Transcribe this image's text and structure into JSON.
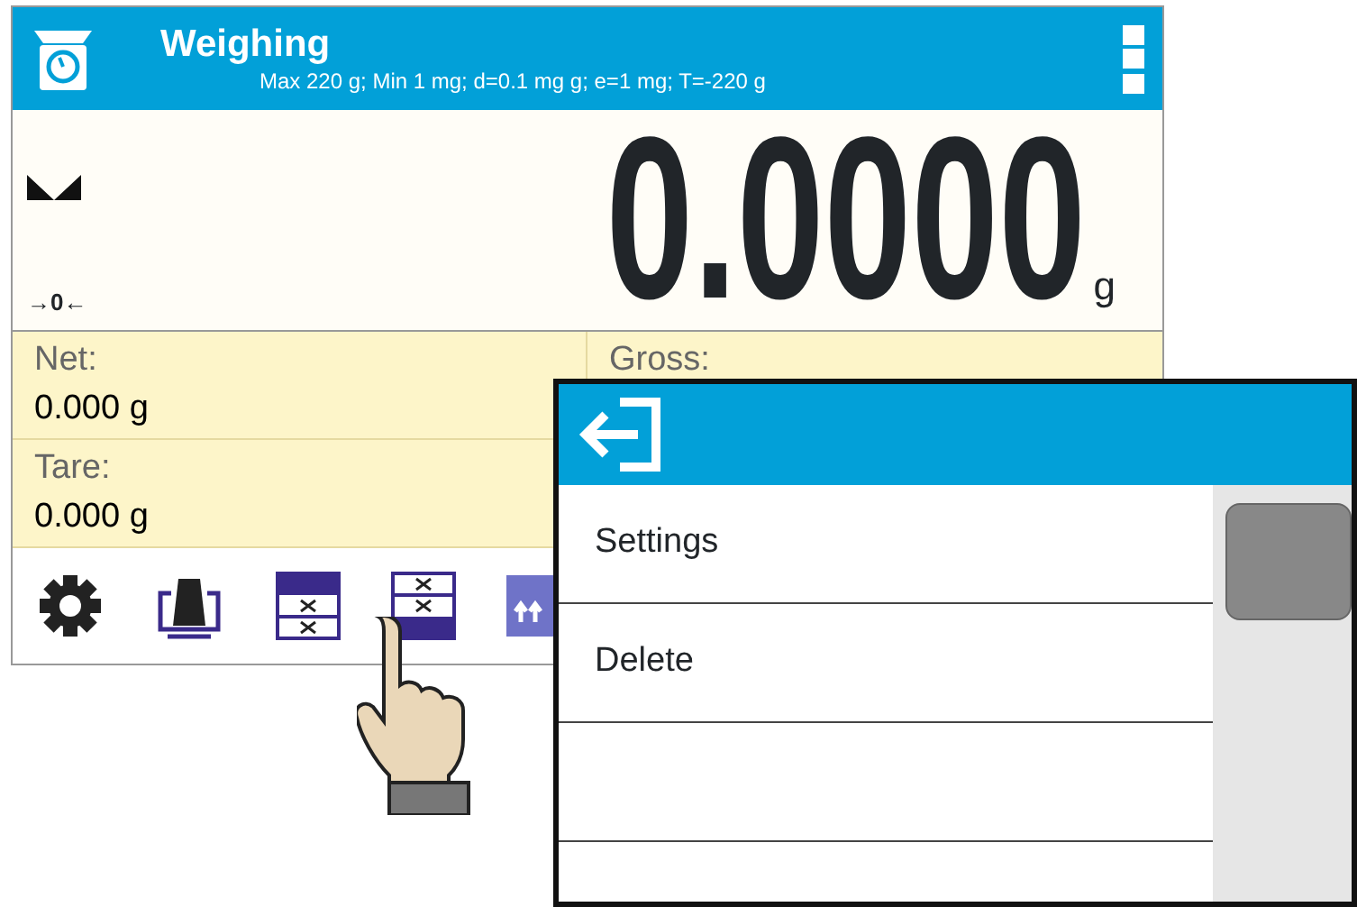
{
  "header": {
    "title": "Weighing",
    "subtitle": "Max 220 g; Min 1 mg; d=0.1 mg g; e=1 mg; T=-220 g"
  },
  "display": {
    "reading": "0.0000",
    "unit": "g",
    "zero_marker": "→0←"
  },
  "fields": [
    {
      "label": "Net:",
      "value": "0.000 g"
    },
    {
      "label": "Gross:"
    },
    {
      "label": "Tare:",
      "value": "0.000 g"
    }
  ],
  "toolbar": [
    {
      "kind": "gear"
    },
    {
      "kind": "tare"
    },
    {
      "kind": "table-top"
    },
    {
      "kind": "table-bottom"
    },
    {
      "kind": "arrows"
    }
  ],
  "popup": {
    "items": [
      {
        "label": "Settings"
      },
      {
        "label": "Delete"
      }
    ]
  }
}
